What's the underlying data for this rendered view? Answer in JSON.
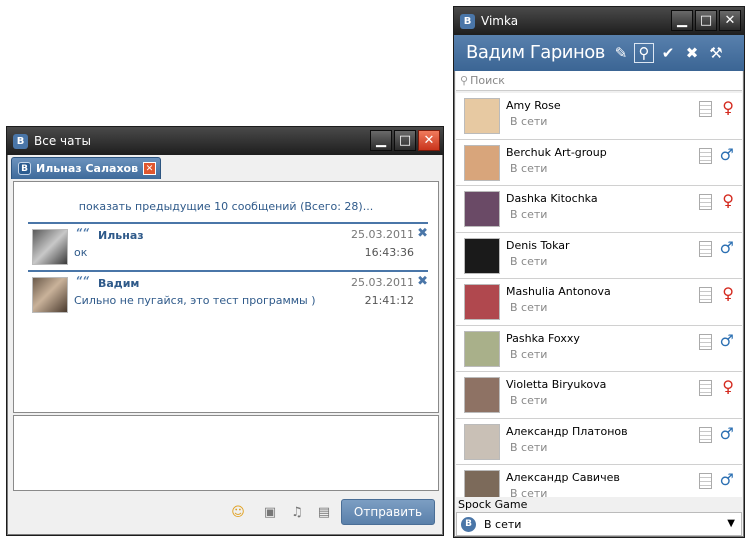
{
  "chat_window": {
    "title": "Все чаты",
    "tab_label": "Ильназ Салахов",
    "load_more": "показать предыдущие 10 сообщений (Всего: 28)...",
    "messages": [
      {
        "author": "Ильназ",
        "text": "ок",
        "date": "25.03.2011",
        "time": "16:43:36"
      },
      {
        "author": "Вадим",
        "text": "Сильно не пугайся, это тест программы )",
        "date": "25.03.2011",
        "time": "21:41:12"
      }
    ],
    "send_label": "Отправить",
    "quote_mark": "““",
    "icons": [
      "smiley-icon",
      "image-icon",
      "music-icon",
      "video-icon"
    ]
  },
  "vimka_window": {
    "title": "Vimka",
    "username": "Вадим Гаринов",
    "search_placeholder": "Поиск",
    "contacts": [
      {
        "name": "Amy Rose",
        "status": "В сети",
        "gender": "f",
        "avatar_color": "#e7c9a2"
      },
      {
        "name": "Berchuk Art-group",
        "status": "В сети",
        "gender": "m",
        "avatar_color": "#d8a57b"
      },
      {
        "name": "Dashka Kitochka",
        "status": "В сети",
        "gender": "f",
        "avatar_color": "#6a4a66"
      },
      {
        "name": "Denis Tokar",
        "status": "В сети",
        "gender": "m",
        "avatar_color": "#1a1a1a"
      },
      {
        "name": "Mashulia Antonova",
        "status": "В сети",
        "gender": "f",
        "avatar_color": "#b0484e"
      },
      {
        "name": "Pashka Foxxy",
        "status": "В сети",
        "gender": "m",
        "avatar_color": "#a9b08a"
      },
      {
        "name": "Violetta Biryukova",
        "status": "В сети",
        "gender": "f",
        "avatar_color": "#8e7264"
      },
      {
        "name": "Александр Платонов",
        "status": "В сети",
        "gender": "m",
        "avatar_color": "#c9c0b6"
      },
      {
        "name": "Александр Савичев",
        "status": "В сети",
        "gender": "m",
        "avatar_color": "#7c6a5a"
      }
    ],
    "game_label": "Spock Game",
    "status_text": "В сети"
  },
  "colors": {
    "accent": "#4a76a8",
    "female": "#d42a1f",
    "male": "#2b6fb2"
  }
}
